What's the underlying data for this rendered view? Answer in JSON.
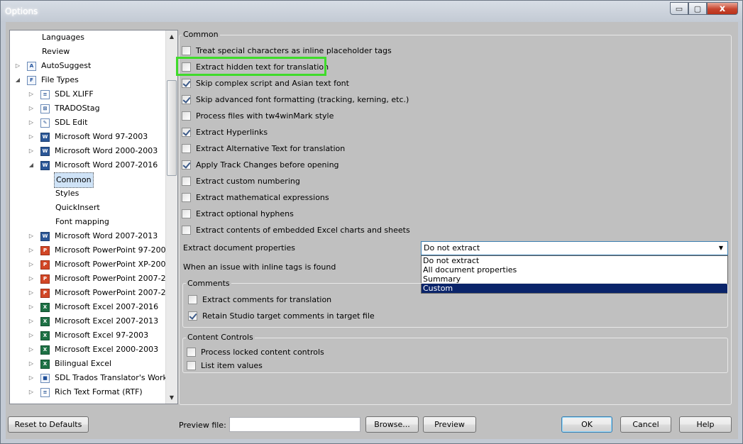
{
  "window": {
    "title": "Options",
    "controls": {
      "minimize": "▭",
      "maximize": "▢",
      "close": "x"
    }
  },
  "tree": {
    "items": [
      {
        "label": "Languages",
        "indent": 2,
        "icon": "",
        "expander": "",
        "selected": false
      },
      {
        "label": "Review",
        "indent": 2,
        "icon": "",
        "expander": "",
        "selected": false
      },
      {
        "label": "AutoSuggest",
        "indent": 1,
        "icon": "autosuggest-icon",
        "expander": "▷",
        "selected": false
      },
      {
        "label": "File Types",
        "indent": 1,
        "icon": "filetypes-icon",
        "expander": "◢",
        "selected": false
      },
      {
        "label": "SDL XLIFF",
        "indent": 2,
        "icon": "sdlxliff-icon",
        "expander": "▷",
        "selected": false
      },
      {
        "label": "TRADOStag",
        "indent": 2,
        "icon": "tradostag-icon",
        "expander": "▷",
        "selected": false
      },
      {
        "label": "SDL Edit",
        "indent": 2,
        "icon": "sdledit-icon",
        "expander": "▷",
        "selected": false
      },
      {
        "label": "Microsoft Word 97-2003",
        "indent": 2,
        "icon": "word-icon",
        "expander": "▷",
        "selected": false
      },
      {
        "label": "Microsoft Word 2000-2003",
        "indent": 2,
        "icon": "word-icon",
        "expander": "▷",
        "selected": false
      },
      {
        "label": "Microsoft Word 2007-2016",
        "indent": 2,
        "icon": "word-icon",
        "expander": "◢",
        "selected": false
      },
      {
        "label": "Common",
        "indent": 3,
        "icon": "",
        "expander": "",
        "selected": true
      },
      {
        "label": "Styles",
        "indent": 3,
        "icon": "",
        "expander": "",
        "selected": false
      },
      {
        "label": "QuickInsert",
        "indent": 3,
        "icon": "",
        "expander": "",
        "selected": false
      },
      {
        "label": "Font mapping",
        "indent": 3,
        "icon": "",
        "expander": "",
        "selected": false
      },
      {
        "label": "Microsoft Word 2007-2013",
        "indent": 2,
        "icon": "word-icon",
        "expander": "▷",
        "selected": false
      },
      {
        "label": "Microsoft PowerPoint 97-200",
        "indent": 2,
        "icon": "powerpoint-icon",
        "expander": "▷",
        "selected": false
      },
      {
        "label": "Microsoft PowerPoint XP-200",
        "indent": 2,
        "icon": "powerpoint-icon",
        "expander": "▷",
        "selected": false
      },
      {
        "label": "Microsoft PowerPoint 2007-2",
        "indent": 2,
        "icon": "powerpoint-icon",
        "expander": "▷",
        "selected": false
      },
      {
        "label": "Microsoft PowerPoint 2007-2",
        "indent": 2,
        "icon": "powerpoint-icon",
        "expander": "▷",
        "selected": false
      },
      {
        "label": "Microsoft Excel 2007-2016",
        "indent": 2,
        "icon": "excel-icon",
        "expander": "▷",
        "selected": false
      },
      {
        "label": "Microsoft Excel 2007-2013",
        "indent": 2,
        "icon": "excel-icon",
        "expander": "▷",
        "selected": false
      },
      {
        "label": "Microsoft Excel 97-2003",
        "indent": 2,
        "icon": "excel-icon",
        "expander": "▷",
        "selected": false
      },
      {
        "label": "Microsoft Excel 2000-2003",
        "indent": 2,
        "icon": "excel-icon",
        "expander": "▷",
        "selected": false
      },
      {
        "label": "Bilingual Excel",
        "indent": 2,
        "icon": "excel-icon",
        "expander": "▷",
        "selected": false
      },
      {
        "label": "SDL Trados Translator's Work",
        "indent": 2,
        "icon": "trados-icon",
        "expander": "▷",
        "selected": false
      },
      {
        "label": "Rich Text Format (RTF)",
        "indent": 2,
        "icon": "rtf-icon",
        "expander": "▷",
        "selected": false
      }
    ],
    "scroll_up": "▲",
    "scroll_down": "▼"
  },
  "common": {
    "legend": "Common",
    "checkboxes": [
      {
        "label": "Treat special characters as inline placeholder tags",
        "checked": false
      },
      {
        "label": "Extract hidden text for translation",
        "checked": false
      },
      {
        "label": "Skip complex script and Asian text font",
        "checked": true
      },
      {
        "label": "Skip advanced font formatting (tracking, kerning, etc.)",
        "checked": true
      },
      {
        "label": "Process files with tw4winMark style",
        "checked": false
      },
      {
        "label": "Extract Hyperlinks",
        "checked": true
      },
      {
        "label": "Extract Alternative Text for translation",
        "checked": false
      },
      {
        "label": "Apply Track Changes before opening",
        "checked": true
      },
      {
        "label": "Extract custom numbering",
        "checked": false
      },
      {
        "label": "Extract mathematical expressions",
        "checked": false
      },
      {
        "label": "Extract optional hyphens",
        "checked": false
      },
      {
        "label": "Extract contents of embedded Excel charts and sheets",
        "checked": false
      }
    ],
    "doc_props_label": "Extract document properties",
    "doc_props_value": "Do not extract",
    "doc_props_arrow": "▼",
    "doc_props_options": [
      "Do not extract",
      "All document properties",
      "Summary",
      "Custom"
    ],
    "doc_props_selected_index": 3,
    "inline_issue_label": "When an issue with inline tags is found"
  },
  "comments": {
    "legend": "Comments",
    "checkboxes": [
      {
        "label": "Extract comments for translation",
        "checked": false
      },
      {
        "label": "Retain Studio target comments in target file",
        "checked": true
      }
    ]
  },
  "content_controls": {
    "legend": "Content Controls",
    "checkboxes": [
      {
        "label": "Process locked content controls",
        "checked": false
      },
      {
        "label": "List item values",
        "checked": false
      }
    ]
  },
  "footer": {
    "reset_label": "Reset to Defaults",
    "preview_file_label": "Preview file:",
    "preview_file_value": "",
    "browse_label": "Browse...",
    "preview_label": "Preview",
    "ok_label": "OK",
    "cancel_label": "Cancel",
    "help_label": "Help"
  },
  "colors": {
    "highlight_box": "#3fdb2a",
    "selection": "#0a246a"
  }
}
